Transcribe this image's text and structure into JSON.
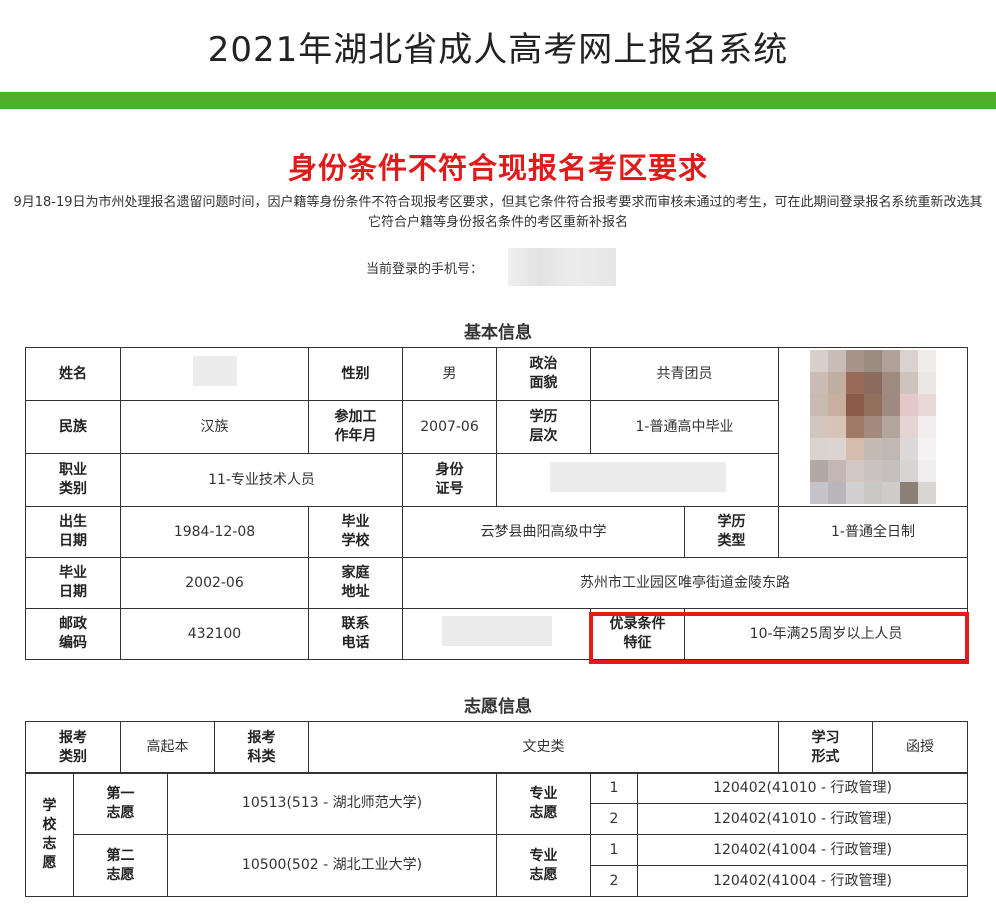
{
  "header": {
    "title": "2021年湖北省成人高考网上报名系统"
  },
  "warning": {
    "heading": "身份条件不符合现报名考区要求",
    "notice": "9月18-19日为市州处理报名遗留问题时间，因户籍等身份条件不符合现报考区要求，但其它条件符合报考要求而审核未通过的考生，可在此期间登录报名系统重新改选其它符合户籍等身份报名条件的考区重新补报名"
  },
  "login": {
    "phone_label": "当前登录的手机号："
  },
  "basic": {
    "title": "基本信息",
    "labels": {
      "name": "姓名",
      "gender": "性别",
      "political": "政治\n面貌",
      "ethnicity": "民族",
      "work_start": "参加工\n作年月",
      "edu_level": "学历\n层次",
      "occupation": "职业\n类别",
      "id_no": "身份\n证号",
      "birth": "出生\n日期",
      "grad_school": "毕业\n学校",
      "edu_type": "学历\n类型",
      "grad_date": "毕业\n日期",
      "address": "家庭\n地址",
      "postcode": "邮政\n编码",
      "contact": "联系\n电话",
      "preferential": "优录条件\n特征"
    },
    "values": {
      "gender": "男",
      "political": "共青团员",
      "ethnicity": "汉族",
      "work_start": "2007-06",
      "edu_level": "1-普通高中毕业",
      "occupation": "11-专业技术人员",
      "birth": "1984-12-08",
      "grad_school": "云梦县曲阳高级中学",
      "edu_type": "1-普通全日制",
      "grad_date": "2002-06",
      "address": "苏州市工业园区唯亭街道金陵东路",
      "postcode": "432100",
      "preferential": "10-年满25周岁以上人员"
    },
    "highlight_color": "#e31a1a"
  },
  "wish": {
    "title": "志愿信息",
    "labels": {
      "exam_category": "报考\n类别",
      "exam_subject": "报考\n科类",
      "study_form": "学习\n形式",
      "school_wish": "学\n校\n志\n愿",
      "major_wish": "专业\n志愿"
    },
    "values": {
      "exam_category": "高起本",
      "exam_subject": "文史类",
      "study_form": "函授"
    },
    "schools": [
      {
        "rank_label": "第一\n志愿",
        "school": "10513(513 - 湖北师范大学)",
        "majors": [
          {
            "no": "1",
            "major": "120402(41010 - 行政管理)"
          },
          {
            "no": "2",
            "major": "120402(41010 - 行政管理)"
          }
        ]
      },
      {
        "rank_label": "第二\n志愿",
        "school": "10500(502 - 湖北工业大学)",
        "majors": [
          {
            "no": "1",
            "major": "120402(41004 - 行政管理)"
          },
          {
            "no": "2",
            "major": "120402(41004 - 行政管理)"
          }
        ]
      }
    ]
  },
  "colors": {
    "accent_green": "#4fae2b",
    "warning_red": "#e01b1b"
  }
}
